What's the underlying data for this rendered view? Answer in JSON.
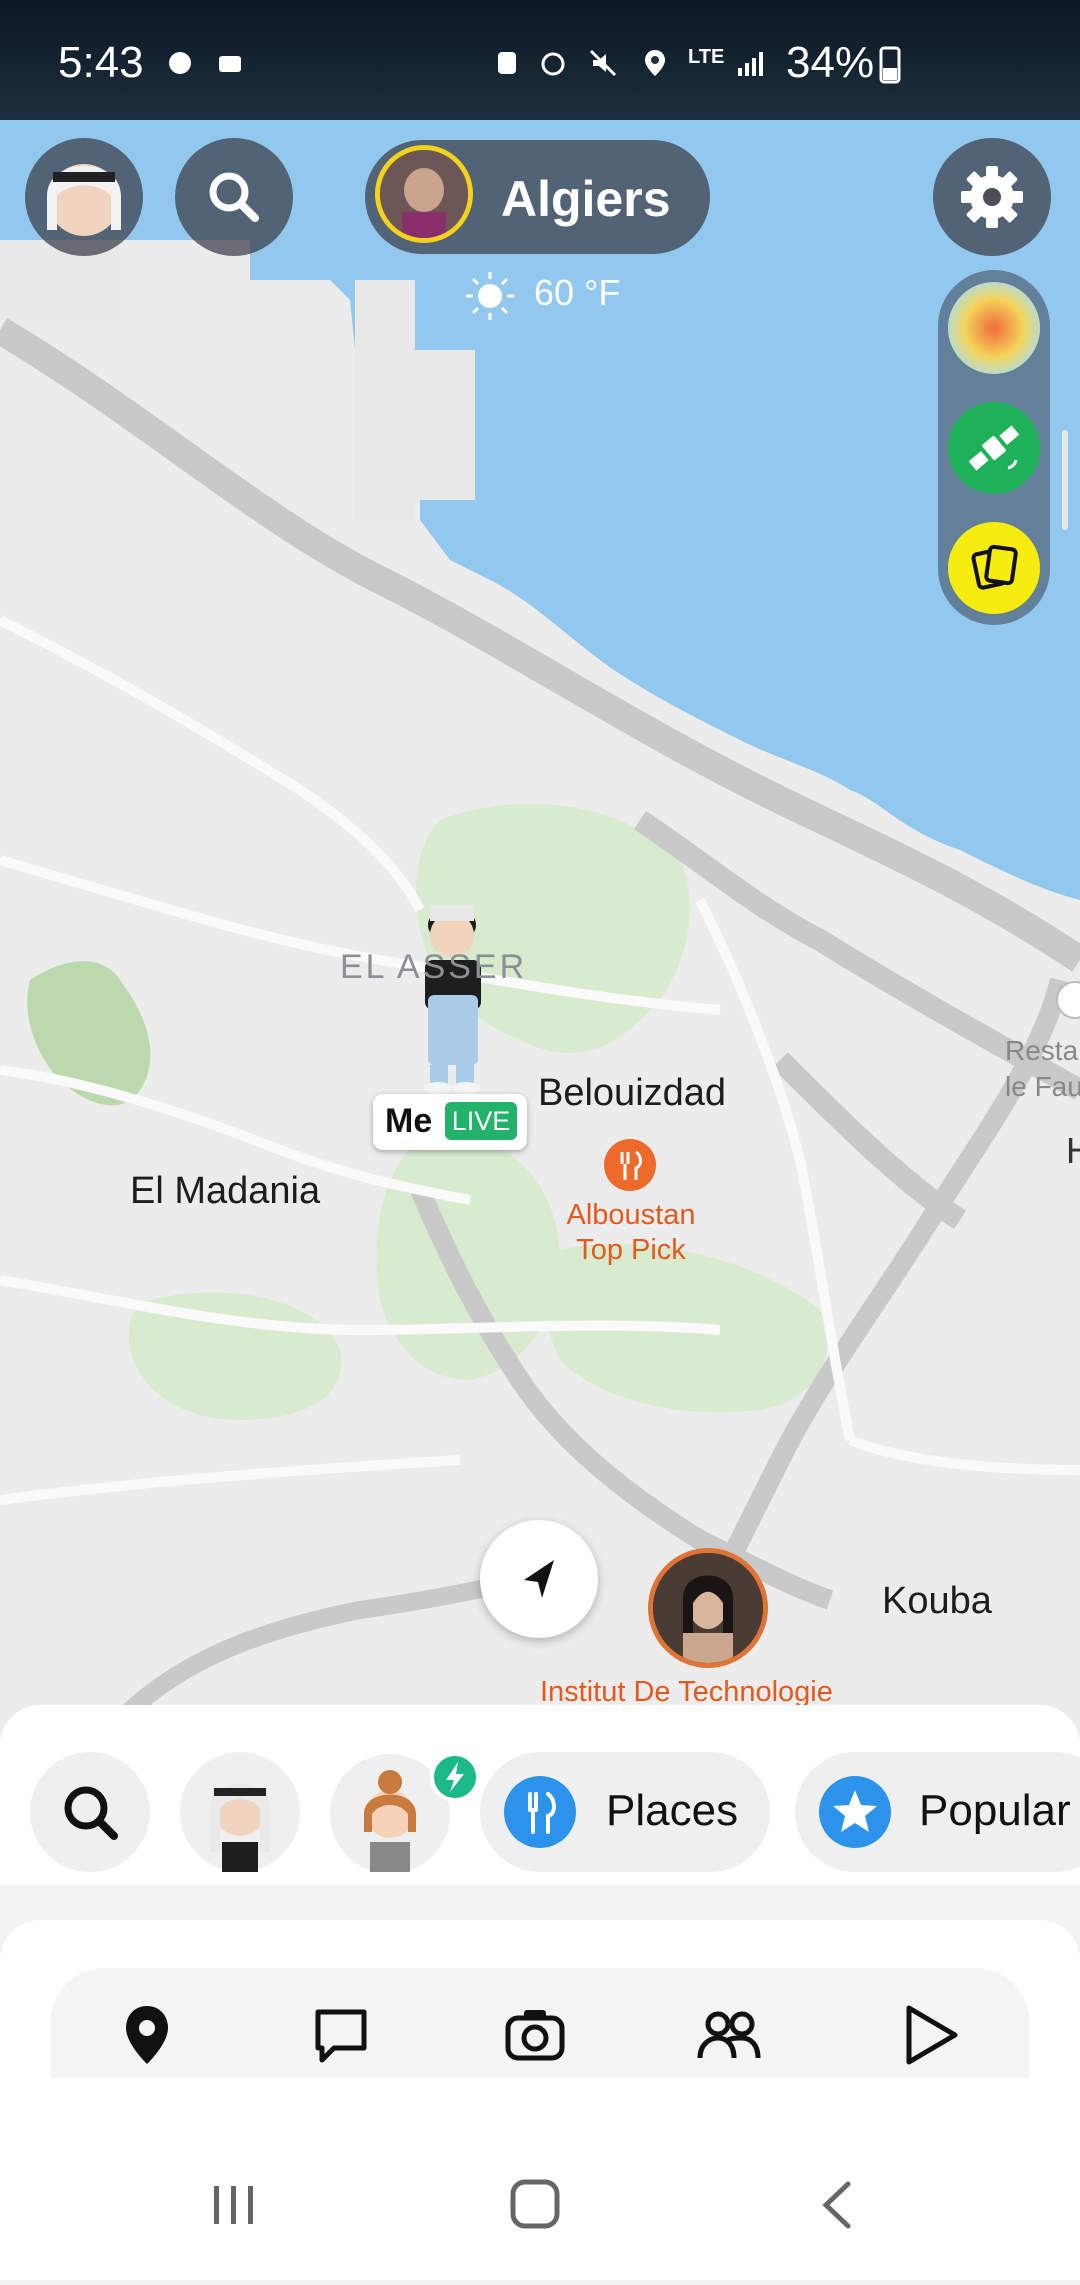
{
  "status_bar": {
    "time": "5:43",
    "battery": "34%",
    "network": "LTE"
  },
  "top": {
    "location": "Algiers",
    "temperature": "60 °F"
  },
  "map": {
    "district": "EL ASSER",
    "towns": [
      "Belouizdad",
      "El Madania",
      "Kouba"
    ],
    "poi": {
      "name": "Alboustan",
      "tag": "Top Pick"
    },
    "place": "Institut De Technologie",
    "edge_labels": [
      "Resta",
      "le Fau",
      "H"
    ]
  },
  "me_marker": {
    "label": "Me",
    "badge": "LIVE"
  },
  "tray": {
    "chips": [
      "Places",
      "Popular"
    ]
  },
  "colors": {
    "water": "#93c8ee",
    "park": "#d8ebce",
    "poi": "#e45a1e",
    "live": "#23b26a",
    "accent_blue": "#2b93ea",
    "ring_yellow": "#f2d21d"
  }
}
